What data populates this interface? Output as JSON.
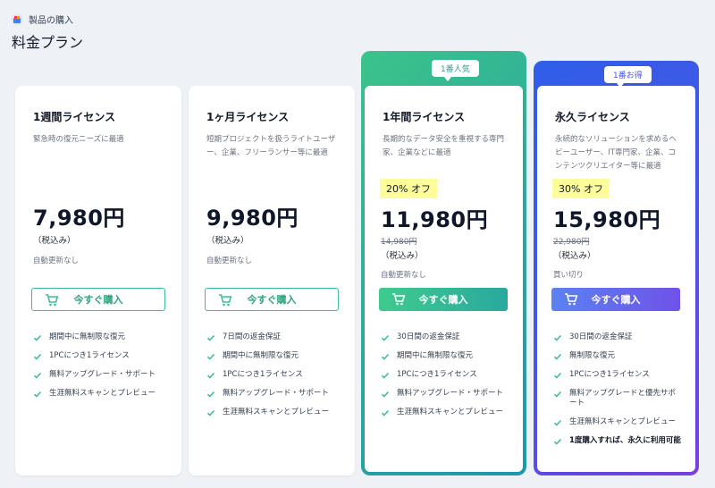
{
  "breadcrumb": {
    "label": "製品の購入"
  },
  "page_title": "料金プラン",
  "colors": {
    "accent_green": "#3cbf8f",
    "accent_purple": "#6f52e8",
    "discount_bg": "#fdfd9c"
  },
  "plans": [
    {
      "name": "1週間ライセンス",
      "desc": "緊急時の復元ニーズに最適",
      "price": "7,980円",
      "tax": "（税込み）",
      "renew": "自動更新なし",
      "buy": "今すぐ購入",
      "features": [
        "期間中に無制限な復元",
        "1PCにつき1ライセンス",
        "無料アップグレード・サポート",
        "生涯無料スキャンとプレビュー"
      ]
    },
    {
      "name": "1ヶ月ライセンス",
      "desc": "短期プロジェクトを扱うライトユーザー、企業、フリーランサー等に最適",
      "price": "9,980円",
      "tax": "（税込み）",
      "renew": "自動更新なし",
      "buy": "今すぐ購入",
      "features": [
        "7日間の返金保証",
        "期間中に無制限な復元",
        "1PCにつき1ライセンス",
        "無料アップグレード・サポート",
        "生涯無料スキャンとプレビュー"
      ]
    },
    {
      "badge": "1番人気",
      "name": "1年間ライセンス",
      "desc": "長期的なデータ安全を重視する専門家、企業などに最適",
      "discount": "20% オフ",
      "price": "11,980円",
      "orig_price": "14,980円",
      "tax": "（税込み）",
      "renew": "自動更新なし",
      "buy": "今すぐ購入",
      "features": [
        "30日間の返金保証",
        "期間中に無制限な復元",
        "1PCにつき1ライセンス",
        "無料アップグレード・サポート",
        "生涯無料スキャンとプレビュー"
      ]
    },
    {
      "badge": "1番お得",
      "name": "永久ライセンス",
      "desc": "永続的なソリューションを求めるヘビーユーザー、IT専門家、企業、コンテンツクリエイター等に最適",
      "discount": "30% オフ",
      "price": "15,980円",
      "orig_price": "22,980円",
      "tax": "（税込み）",
      "renew": "買い切り",
      "buy": "今すぐ購入",
      "features": [
        "30日間の返金保証",
        "無制限な復元",
        "1PCにつき1ライセンス",
        "無料アップグレードと優先サポート",
        "生涯無料スキャンとプレビュー",
        "1度購入すれば、永久に利用可能"
      ]
    }
  ]
}
